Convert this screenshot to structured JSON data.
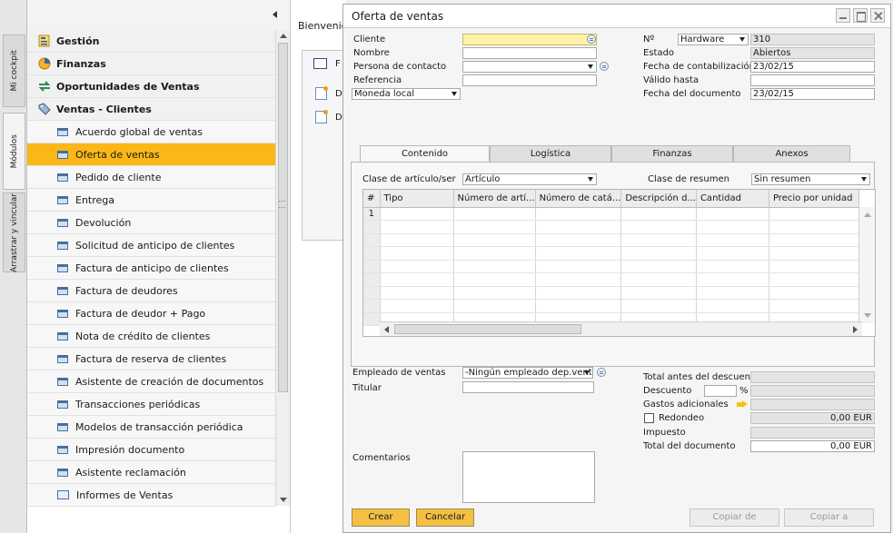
{
  "vtabs": [
    "Mi cockpit",
    "Módulos",
    "Arrastrar y vincular"
  ],
  "menu": {
    "modules": [
      "Gestión",
      "Finanzas",
      "Oportunidades de Ventas",
      "Ventas - Clientes"
    ],
    "items": [
      "Acuerdo global de ventas",
      "Oferta de ventas",
      "Pedido de cliente",
      "Entrega",
      "Devolución",
      "Solicitud de anticipo de clientes",
      "Factura de anticipo de clientes",
      "Factura de deudores",
      "Factura de deudor + Pago",
      "Nota de crédito de clientes",
      "Factura de reserva de clientes",
      "Asistente de creación de documentos",
      "Transacciones periódicas",
      "Modelos de transacción periódica",
      "Impresión documento",
      "Asistente reclamación",
      "Informes de Ventas"
    ],
    "selected": "Oferta de ventas"
  },
  "cockpit": {
    "welcome": "Bienvenid",
    "panel_label": "F",
    "item_prefix": "D"
  },
  "window": {
    "title": "Oferta de ventas",
    "header_left": {
      "cliente_label": "Cliente",
      "cliente_value": "",
      "nombre_label": "Nombre",
      "nombre_value": "",
      "contacto_label": "Persona de contacto",
      "contacto_value": "",
      "referencia_label": "Referencia",
      "referencia_value": "",
      "moneda_value": "Moneda local"
    },
    "header_right": {
      "no_label": "Nº",
      "series": "Hardware",
      "number": "310",
      "estado_label": "Estado",
      "estado_value": "Abiertos",
      "fecha_cont_label": "Fecha de contabilización",
      "fecha_cont_value": "23/02/15",
      "valido_label": "Válido hasta",
      "valido_value": "",
      "fecha_doc_label": "Fecha del documento",
      "fecha_doc_value": "23/02/15"
    },
    "tabs": [
      "Contenido",
      "Logística",
      "Finanzas",
      "Anexos"
    ],
    "active_tab": "Contenido",
    "content": {
      "clase_label": "Clase de artículo/ser",
      "clase_value": "Artículo",
      "resumen_label": "Clase de resumen",
      "resumen_value": "Sin resumen",
      "columns": [
        "#",
        "Tipo",
        "Número de artí...",
        "Número de catá...",
        "Descripción d...",
        "Cantidad",
        "Precio por unidad"
      ],
      "rows": [
        [
          "1",
          "",
          "",
          "",
          "",
          "",
          ""
        ]
      ]
    },
    "footer_left": {
      "empleado_label": "Empleado de ventas",
      "empleado_value": "-Ningún empleado dep.ventas-",
      "titular_label": "Titular",
      "titular_value": "",
      "comentarios_label": "Comentarios"
    },
    "footer_right": {
      "total_antes_label": "Total antes del descuento",
      "total_antes_value": "",
      "descuento_label": "Descuento",
      "descuento_pct": "",
      "pct_sign": "%",
      "descuento_value": "",
      "gastos_label": "Gastos adicionales",
      "gastos_value": "",
      "redondeo_label": "Redondeo",
      "redondeo_value": "0,00 EUR",
      "impuesto_label": "Impuesto",
      "impuesto_value": "",
      "total_doc_label": "Total del documento",
      "total_doc_value": "0,00 EUR"
    },
    "buttons": {
      "crear": "Crear",
      "cancelar": "Cancelar",
      "copiar_de": "Copiar de",
      "copiar_a": "Copiar a"
    }
  }
}
